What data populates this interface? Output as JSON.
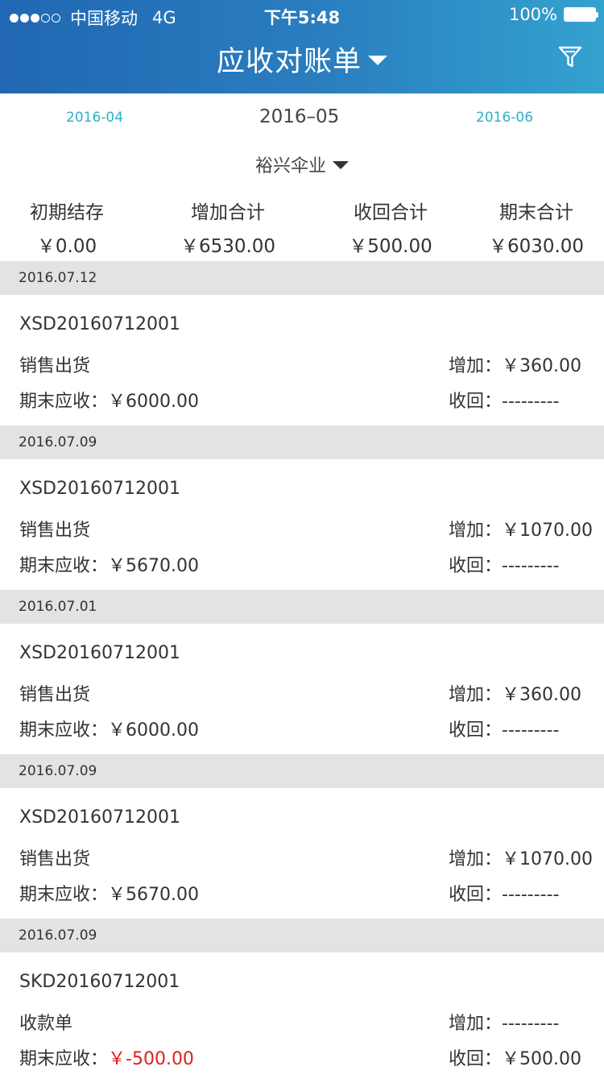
{
  "status_bar": {
    "carrier": "中国移动",
    "network": "4G",
    "time": "下午5:48",
    "battery": "100%"
  },
  "header": {
    "title": "应收对账单",
    "filter_icon": "filter-icon"
  },
  "months": {
    "prev": "2016-04",
    "current": "2016–05",
    "next": "2016-06"
  },
  "company": {
    "name": "裕兴伞业"
  },
  "summary": [
    {
      "label": "初期结存",
      "value": "￥0.00"
    },
    {
      "label": "增加合计",
      "value": "￥6530.00"
    },
    {
      "label": "收回合计",
      "value": "￥500.00"
    },
    {
      "label": "期末合计",
      "value": "￥6030.00"
    }
  ],
  "entries": [
    {
      "date": "2016.07.12",
      "doc_no": "XSD20160712001",
      "doc_type": "销售出货",
      "ending_label": "期末应收：",
      "ending_value": "￥6000.00",
      "increase_label": "增加：",
      "increase_value": "￥360.00",
      "recovered_label": "收回：",
      "recovered_value": "---------"
    },
    {
      "date": "2016.07.09",
      "doc_no": "XSD20160712001",
      "doc_type": "销售出货",
      "ending_label": "期末应收：",
      "ending_value": "￥5670.00",
      "increase_label": "增加：",
      "increase_value": "￥1070.00",
      "recovered_label": "收回：",
      "recovered_value": "---------"
    },
    {
      "date": "2016.07.01",
      "doc_no": "XSD20160712001",
      "doc_type": "销售出货",
      "ending_label": "期末应收：",
      "ending_value": "￥6000.00",
      "increase_label": "增加：",
      "increase_value": "￥360.00",
      "recovered_label": "收回：",
      "recovered_value": "---------"
    },
    {
      "date": "2016.07.09",
      "doc_no": "XSD20160712001",
      "doc_type": "销售出货",
      "ending_label": "期末应收：",
      "ending_value": "￥5670.00",
      "increase_label": "增加：",
      "increase_value": "￥1070.00",
      "recovered_label": "收回：",
      "recovered_value": "---------"
    },
    {
      "date": "2016.07.09",
      "doc_no": "SKD20160712001",
      "doc_type": "收款单",
      "ending_label": "期末应收：",
      "ending_value": "￥-500.00",
      "increase_label": "增加：",
      "increase_value": "---------",
      "recovered_label": "收回：",
      "recovered_value": "￥500.00"
    }
  ],
  "colors": {
    "header_start": "#2167b3",
    "header_end": "#34a2cf",
    "month_link": "#2fb0c7",
    "negative": "#e02020",
    "date_bar": "#e3e3e3"
  }
}
